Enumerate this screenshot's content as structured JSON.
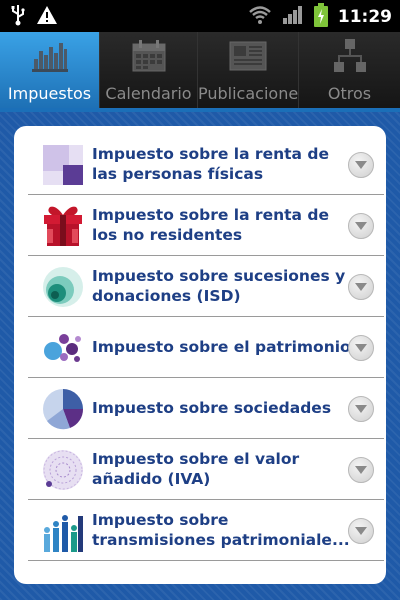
{
  "statusbar": {
    "time": "11:29",
    "icons": [
      "usb-icon",
      "warning-icon",
      "wifi-icon",
      "signal-icon",
      "battery-charging-icon"
    ]
  },
  "tabs": [
    {
      "label": "Impuestos",
      "icon": "bar-chart-icon",
      "active": true
    },
    {
      "label": "Calendario",
      "icon": "calendar-icon",
      "active": false
    },
    {
      "label": "Publicaciones",
      "icon": "newspaper-icon",
      "active": false
    },
    {
      "label": "Otros",
      "icon": "network-icon",
      "active": false
    }
  ],
  "list": [
    {
      "title": "Impuesto sobre la renta de las personas físicas",
      "icon": "purple-squares-icon"
    },
    {
      "title": "Impuesto sobre la renta de los no residentes",
      "icon": "gift-box-icon"
    },
    {
      "title": "Impuesto sobre sucesiones y donaciones (ISD)",
      "icon": "teal-circles-icon"
    },
    {
      "title": "Impuesto sobre el patrimonio",
      "icon": "bubbles-icon"
    },
    {
      "title": "Impuesto sobre sociedades",
      "icon": "pie-chart-icon"
    },
    {
      "title": "Impuesto sobre el valor añadido (IVA)",
      "icon": "dotted-circle-icon"
    },
    {
      "title": "Impuesto sobre transmisiones patrimoniale...",
      "icon": "bars-people-icon"
    }
  ],
  "colors": {
    "accent": "#1f5aa8",
    "title_text": "#1e3f85",
    "tab_active": "#2f8fd8"
  }
}
